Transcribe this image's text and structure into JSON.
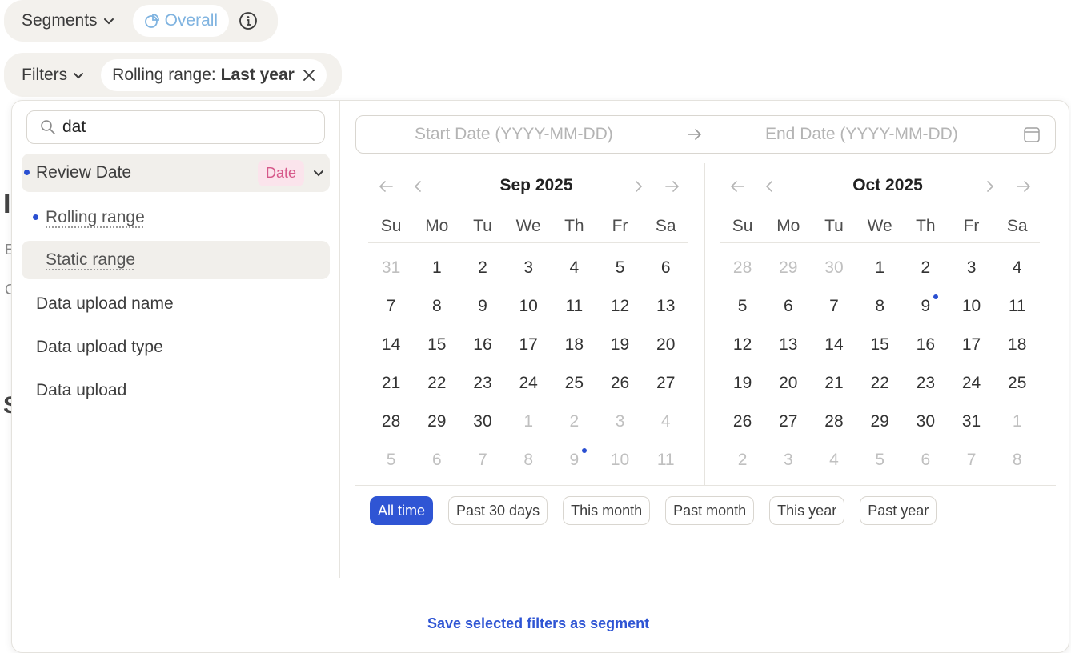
{
  "segments": {
    "label": "Segments",
    "overall_label": "Overall"
  },
  "filters": {
    "label": "Filters",
    "active_filter_prefix": "Rolling range: ",
    "active_filter_value": "Last year"
  },
  "background_fragments": [
    "I",
    "E",
    "C",
    "S"
  ],
  "search": {
    "value": "dat"
  },
  "field_list": {
    "review_date": "Review Date",
    "review_date_badge": "Date",
    "rolling_range": "Rolling range",
    "static_range": "Static range",
    "data_upload_name": "Data upload name",
    "data_upload_type": "Data upload type",
    "data_upload": "Data upload"
  },
  "range_input": {
    "start_placeholder": "Start Date (YYYY-MM-DD)",
    "end_placeholder": "End Date (YYYY-MM-DD)"
  },
  "weekdays": [
    "Su",
    "Mo",
    "Tu",
    "We",
    "Th",
    "Fr",
    "Sa"
  ],
  "calendars": [
    {
      "title": "Sep 2025",
      "days": [
        {
          "d": "31",
          "m": true
        },
        {
          "d": "1"
        },
        {
          "d": "2"
        },
        {
          "d": "3"
        },
        {
          "d": "4"
        },
        {
          "d": "5"
        },
        {
          "d": "6"
        },
        {
          "d": "7"
        },
        {
          "d": "8"
        },
        {
          "d": "9"
        },
        {
          "d": "10"
        },
        {
          "d": "11"
        },
        {
          "d": "12"
        },
        {
          "d": "13"
        },
        {
          "d": "14"
        },
        {
          "d": "15"
        },
        {
          "d": "16"
        },
        {
          "d": "17"
        },
        {
          "d": "18"
        },
        {
          "d": "19"
        },
        {
          "d": "20"
        },
        {
          "d": "21"
        },
        {
          "d": "22"
        },
        {
          "d": "23"
        },
        {
          "d": "24"
        },
        {
          "d": "25"
        },
        {
          "d": "26"
        },
        {
          "d": "27"
        },
        {
          "d": "28"
        },
        {
          "d": "29"
        },
        {
          "d": "30"
        },
        {
          "d": "1",
          "m": true
        },
        {
          "d": "2",
          "m": true
        },
        {
          "d": "3",
          "m": true
        },
        {
          "d": "4",
          "m": true
        },
        {
          "d": "5",
          "m": true
        },
        {
          "d": "6",
          "m": true
        },
        {
          "d": "7",
          "m": true
        },
        {
          "d": "8",
          "m": true
        },
        {
          "d": "9",
          "m": true,
          "today": true
        },
        {
          "d": "10",
          "m": true
        },
        {
          "d": "11",
          "m": true
        }
      ]
    },
    {
      "title": "Oct 2025",
      "days": [
        {
          "d": "28",
          "m": true
        },
        {
          "d": "29",
          "m": true
        },
        {
          "d": "30",
          "m": true
        },
        {
          "d": "1"
        },
        {
          "d": "2"
        },
        {
          "d": "3"
        },
        {
          "d": "4"
        },
        {
          "d": "5"
        },
        {
          "d": "6"
        },
        {
          "d": "7"
        },
        {
          "d": "8"
        },
        {
          "d": "9",
          "today": true
        },
        {
          "d": "10"
        },
        {
          "d": "11"
        },
        {
          "d": "12"
        },
        {
          "d": "13"
        },
        {
          "d": "14"
        },
        {
          "d": "15"
        },
        {
          "d": "16"
        },
        {
          "d": "17"
        },
        {
          "d": "18"
        },
        {
          "d": "19"
        },
        {
          "d": "20"
        },
        {
          "d": "21"
        },
        {
          "d": "22"
        },
        {
          "d": "23"
        },
        {
          "d": "24"
        },
        {
          "d": "25"
        },
        {
          "d": "26"
        },
        {
          "d": "27"
        },
        {
          "d": "28"
        },
        {
          "d": "29"
        },
        {
          "d": "30"
        },
        {
          "d": "31"
        },
        {
          "d": "1",
          "m": true
        },
        {
          "d": "2",
          "m": true
        },
        {
          "d": "3",
          "m": true
        },
        {
          "d": "4",
          "m": true
        },
        {
          "d": "5",
          "m": true
        },
        {
          "d": "6",
          "m": true
        },
        {
          "d": "7",
          "m": true
        },
        {
          "d": "8",
          "m": true
        }
      ]
    }
  ],
  "presets": [
    "All time",
    "Past 30 days",
    "This month",
    "Past month",
    "This year",
    "Past year"
  ],
  "active_preset": "All time",
  "save_link": "Save selected filters as segment",
  "colors": {
    "accent": "#2f55d4",
    "overall_pill": "#7fb3e0",
    "date_badge_bg": "#fbe4ec",
    "date_badge_text": "#d6588a",
    "bar_bg": "#f3f1ed"
  },
  "icons": [
    "chevron-down-icon",
    "segment-pie-icon",
    "info-icon",
    "close-icon",
    "search-icon",
    "arrow-right-icon",
    "calendar-icon",
    "double-left-icon",
    "left-icon",
    "right-icon",
    "double-right-icon"
  ]
}
